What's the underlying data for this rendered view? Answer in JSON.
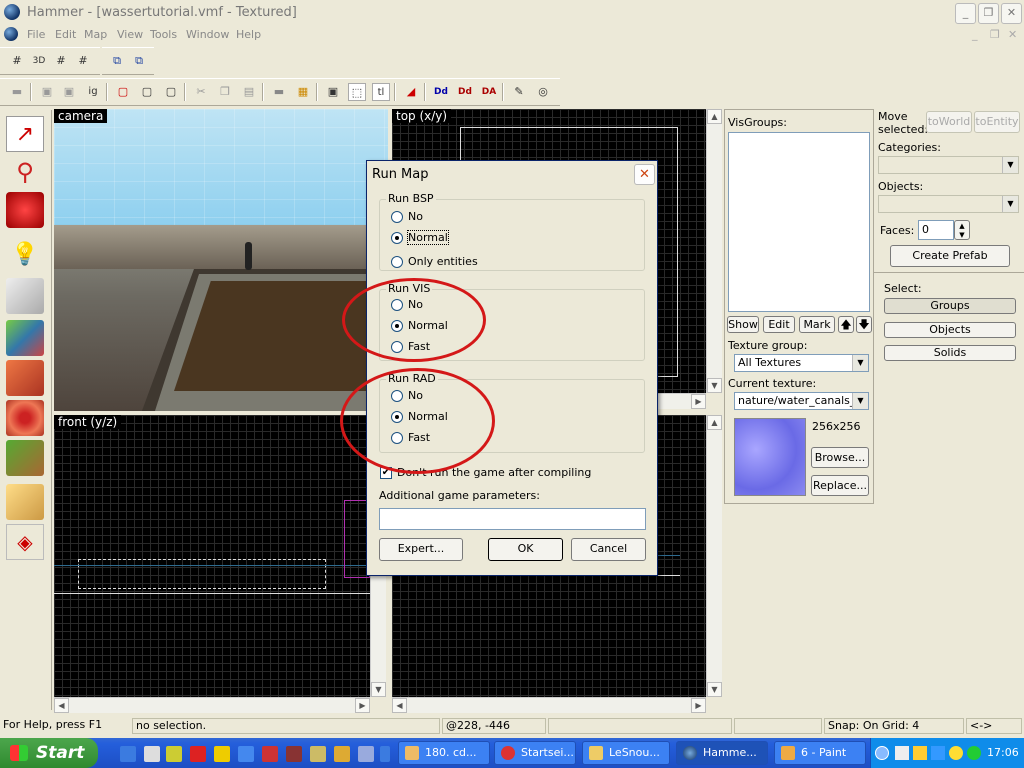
{
  "window": {
    "title": "Hammer - [wassertutorial.vmf - Textured]"
  },
  "menu": [
    "File",
    "Edit",
    "Map",
    "View",
    "Tools",
    "Window",
    "Help"
  ],
  "views": {
    "camera": "camera",
    "top": "top (x/y)",
    "front": "front (y/z)"
  },
  "visgroups": {
    "label": "VisGroups:",
    "buttons": [
      "Show",
      "Edit",
      "Mark"
    ]
  },
  "texture": {
    "group_label": "Texture group:",
    "group_value": "All Textures",
    "current_label": "Current texture:",
    "current_value": "nature/water_canals_w",
    "size": "256x256",
    "browse": "Browse...",
    "replace": "Replace..."
  },
  "right_panel": {
    "move_selected": "Move selected:",
    "to_world": "toWorld",
    "to_entity": "toEntity",
    "categories": "Categories:",
    "objects": "Objects:",
    "faces": "Faces:",
    "faces_value": "0",
    "create_prefab": "Create Prefab",
    "select": "Select:",
    "select_buttons": [
      "Groups",
      "Objects",
      "Solids"
    ]
  },
  "dialog": {
    "title": "Run Map",
    "bsp": {
      "legend": "Run BSP",
      "options": [
        "No",
        "Normal",
        "Only entities"
      ],
      "selected": "Normal"
    },
    "vis": {
      "legend": "Run VIS",
      "options": [
        "No",
        "Normal",
        "Fast"
      ],
      "selected": "Normal"
    },
    "rad": {
      "legend": "Run RAD",
      "options": [
        "No",
        "Normal",
        "Fast"
      ],
      "selected": "Normal"
    },
    "dont_run_label": "Don't run the game after compiling",
    "dont_run_checked": true,
    "params_label": "Additional game parameters:",
    "params_value": "",
    "expert": "Expert...",
    "ok": "OK",
    "cancel": "Cancel"
  },
  "status": {
    "help": "For Help, press F1",
    "selection": "no selection.",
    "coords": "@228, -446",
    "snap": "Snap: On Grid: 4",
    "arrows": "<->"
  },
  "taskbar": {
    "start": "Start",
    "tasks": [
      "180. cd...",
      "Startsei...",
      "LeSnou...",
      "Hamme...",
      "6 - Paint"
    ],
    "active_task": "Hamme...",
    "clock": "17:06"
  },
  "colors": {
    "annotation_red": "#d41818",
    "xp_blue": "#245edb",
    "selection_yellow": "#ffffff"
  }
}
